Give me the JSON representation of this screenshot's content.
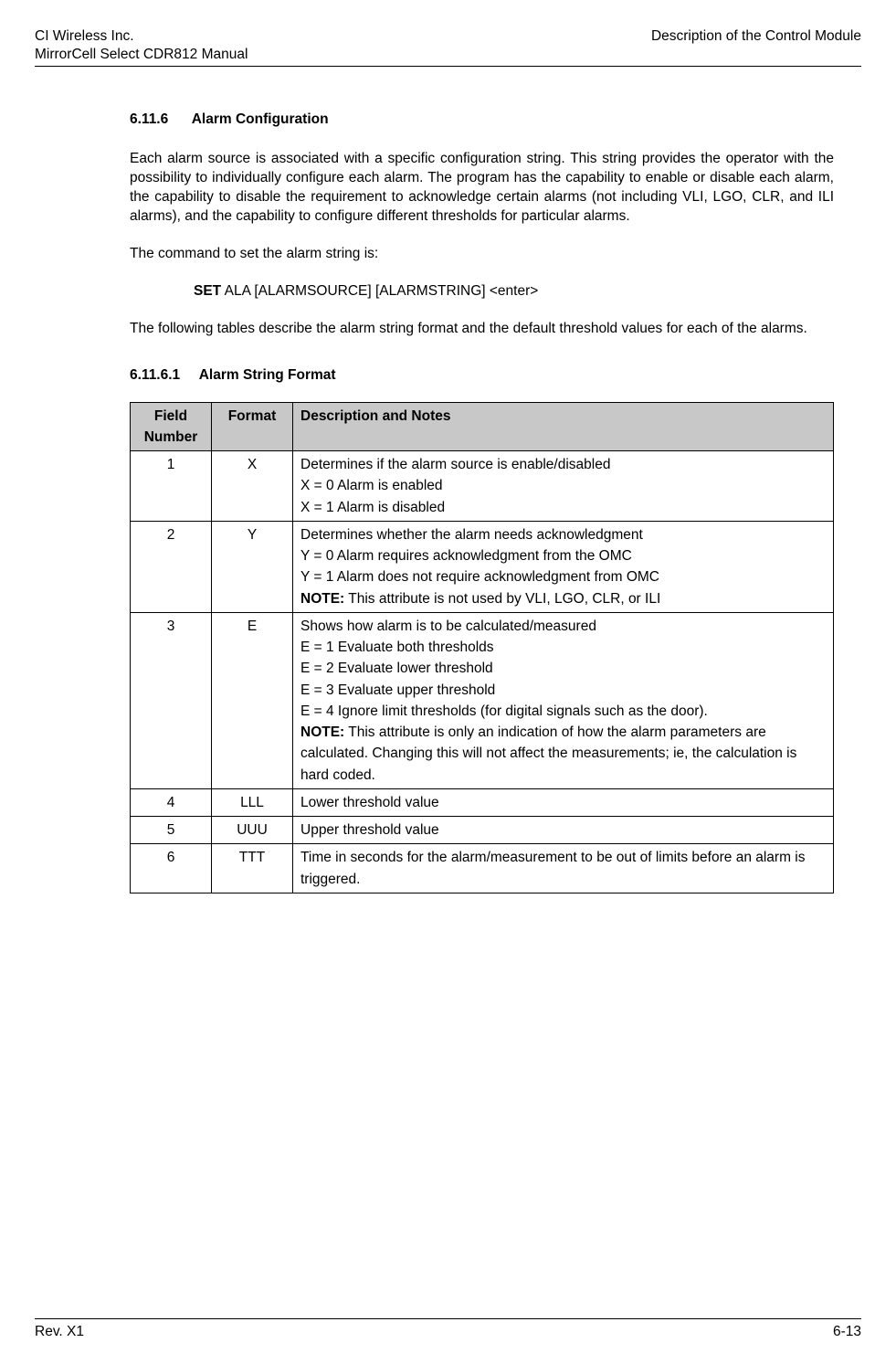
{
  "header": {
    "company": "CI Wireless Inc.",
    "manual": "MirrorCell Select CDR812 Manual",
    "title": "Description of the Control Module"
  },
  "section": {
    "number": "6.11.6",
    "title": "Alarm Configuration",
    "para1": "Each alarm source is associated with a specific configuration string. This string provides the operator with the possibility to individually configure each alarm. The program has the capability to enable or disable each alarm, the capability to disable the requirement to acknowledge certain alarms (not including VLI, LGO, CLR, and ILI alarms), and the capability to configure different thresholds for particular alarms.",
    "para2": "The command to set the alarm string is:",
    "cmd_bold": "SET",
    "cmd_rest": " ALA [ALARMSOURCE] [ALARMSTRING] <enter>",
    "para3": "The following tables describe the alarm string format and the default threshold values for each of the alarms."
  },
  "subsection": {
    "number": "6.11.6.1",
    "title": "Alarm String Format"
  },
  "table": {
    "headers": {
      "field_number": "Field Number",
      "format": "Format",
      "description": "Description and Notes"
    },
    "rows": [
      {
        "num": "1",
        "fmt": "X",
        "desc_lines": [
          {
            "text": "Determines if the alarm source is enable/disabled"
          },
          {
            "text": "X = 0  Alarm is enabled"
          },
          {
            "text": "X = 1  Alarm is disabled"
          }
        ]
      },
      {
        "num": "2",
        "fmt": "Y",
        "desc_lines": [
          {
            "text": "Determines whether the alarm needs acknowledgment"
          },
          {
            "text": "Y = 0  Alarm requires acknowledgment from the OMC"
          },
          {
            "text": "Y = 1  Alarm does not require acknowledgment from OMC"
          },
          {
            "bold": "NOTE:",
            "text": " This attribute is not used by VLI, LGO, CLR, or ILI"
          }
        ]
      },
      {
        "num": "3",
        "fmt": "E",
        "desc_lines": [
          {
            "text": "Shows how alarm is to be calculated/measured"
          },
          {
            "text": "E = 1  Evaluate both thresholds"
          },
          {
            "text": "E = 2  Evaluate lower threshold"
          },
          {
            "text": "E = 3  Evaluate upper threshold"
          },
          {
            "text": "E = 4  Ignore limit thresholds (for digital signals such as the door)."
          },
          {
            "bold": "NOTE:",
            "text": " This attribute is only an indication of how the alarm parameters are calculated. Changing this will not affect the measurements; ie, the calculation is hard coded."
          }
        ]
      },
      {
        "num": "4",
        "fmt": "LLL",
        "desc_lines": [
          {
            "text": "Lower threshold value"
          }
        ]
      },
      {
        "num": "5",
        "fmt": "UUU",
        "desc_lines": [
          {
            "text": "Upper threshold value"
          }
        ]
      },
      {
        "num": "6",
        "fmt": "TTT",
        "desc_lines": [
          {
            "text": "Time in seconds for the alarm/measurement to be out of limits before an alarm is triggered."
          }
        ]
      }
    ]
  },
  "footer": {
    "rev": "Rev. X1",
    "page": "6-13"
  }
}
